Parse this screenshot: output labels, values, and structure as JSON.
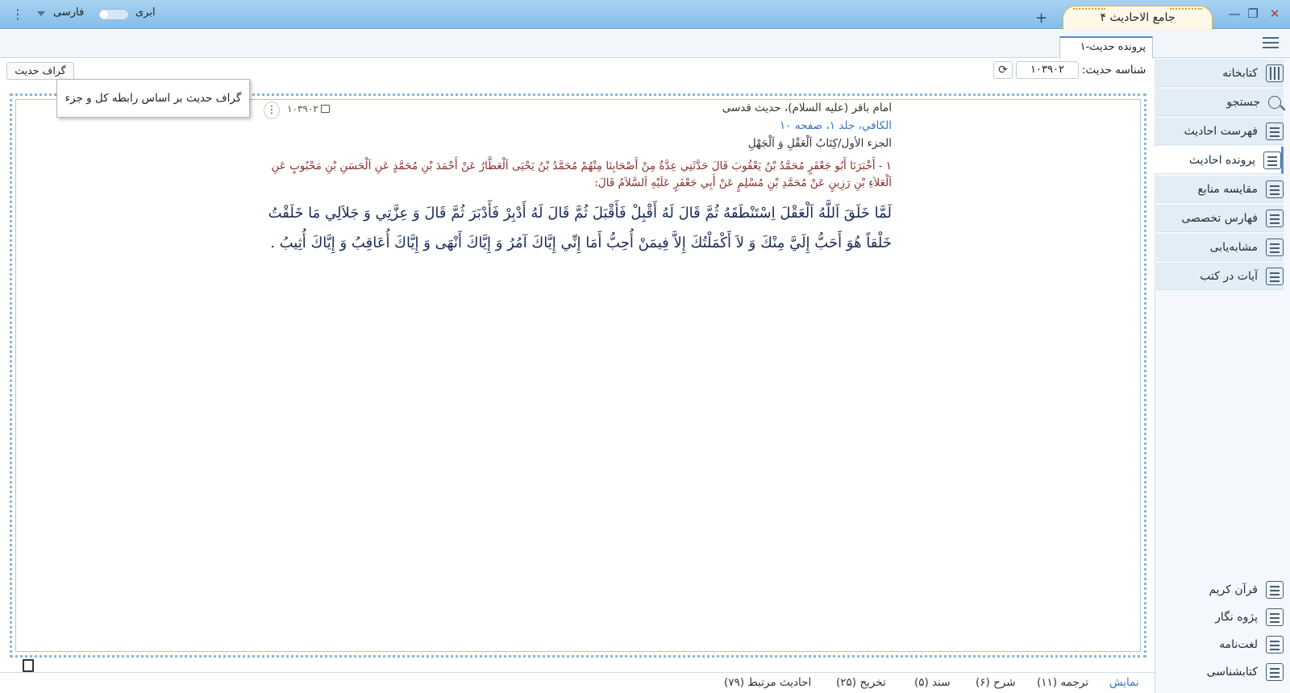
{
  "window": {
    "title": "جامع الاحادیث ۴",
    "new_tab": "+",
    "minimize": "—",
    "restore": "❐",
    "close": "✕",
    "language": "فارسی",
    "cloud_label": "ابری",
    "menu": "⋮"
  },
  "tabs": [
    {
      "label": "پرونده حدیث-۱"
    }
  ],
  "toolbar": {
    "graph_button": "گراف حدیث",
    "id_label": "شناسه حدیث:",
    "id_value": "۱۰۳۹۰۲",
    "refresh": "⟳"
  },
  "tooltip": "گراف حدیث بر اساس رابطه کل و جزء",
  "sidebar": {
    "items": [
      {
        "label": "کتابخانه",
        "icon": "books-icon"
      },
      {
        "label": "جستجو",
        "icon": "search-icon"
      },
      {
        "label": "فهرست احادیث",
        "icon": "list-search-icon"
      },
      {
        "label": "پرونده احادیث",
        "icon": "document-icon"
      },
      {
        "label": "مقایسه منابع",
        "icon": "compare-icon"
      },
      {
        "label": "فهارس تخصصی",
        "icon": "index-icon"
      },
      {
        "label": "مشابه‌یابی",
        "icon": "similar-icon"
      },
      {
        "label": "آیات در کتب",
        "icon": "verses-icon"
      }
    ],
    "bottom": [
      {
        "label": "قرآن کریم",
        "icon": "quran-icon"
      },
      {
        "label": "پژوه نگار",
        "icon": "notebook-icon"
      },
      {
        "label": "لغت‌نامه",
        "icon": "dictionary-icon"
      },
      {
        "label": "کتابشناسی",
        "icon": "info-icon"
      }
    ]
  },
  "hadith": {
    "id": "۱۰۳۹۰۲",
    "narrator": "امام باقر (علیه السلام)، حدیث قدسی",
    "source": "الکافي، جلد ۱، صفحه ۱۰",
    "chapter": "الجزء الأول/كِتَابُ اَلْعَقْلِ وَ اَلْجَهْلِ",
    "sanad": "۱ - أَخْبَرَنَا أَبُو جَعْفَرٍ مُحَمَّدُ بْنُ يَعْقُوبَ قَالَ حَدَّثَنِي عِدَّةٌ مِنْ أَصْحَابِنَا مِنْهُمْ مُحَمَّدُ بْنُ يَحْيَى اَلْعَطَّارُ عَنْ أَحْمَدَ بْنِ مُحَمَّدٍ عَنِ اَلْحَسَنِ بْنِ مَحْبُوبٍ عَنِ اَلْعَلاَءِ بْنِ رَزِينٍ عَنْ مُحَمَّدِ بْنِ مُسْلِمٍ عَنْ أَبِي جَعْفَرٍ عَلَيْهِ اَلسَّلاَمُ قَالَ:",
    "matn": "لَمَّا خَلَقَ اَللَّهُ اَلْعَقْلَ اِسْتَنْطَقَهُ ثُمَّ قَالَ لَهُ أَقْبِلْ فَأَقْبَلَ ثُمَّ قَالَ لَهُ أَدْبِرْ فَأَدْبَرَ ثُمَّ قَالَ وَ عِزَّتِي وَ جَلاَلِي مَا خَلَقْتُ خَلْقاً هُوَ أَحَبُّ إِلَيَّ مِنْكَ وَ لاَ أَكْمَلْتُكَ إِلاَّ فِيمَنْ أُحِبُّ أَمَا إِنِّي إِيَّاكَ آمُرُ وَ إِيَّاكَ أَنْهَى وَ إِيَّاكَ أُعَاقِبُ وَ إِيَّاكَ أُثِيبُ ."
  },
  "status_tabs": [
    {
      "label": "نمایش",
      "active": true
    },
    {
      "label": "ترجمه (۱۱)"
    },
    {
      "label": "شرح (۶)"
    },
    {
      "label": "سند (۵)"
    },
    {
      "label": "تخریج (۲۵)"
    },
    {
      "label": "احادیث مرتبط (۷۹)"
    }
  ]
}
